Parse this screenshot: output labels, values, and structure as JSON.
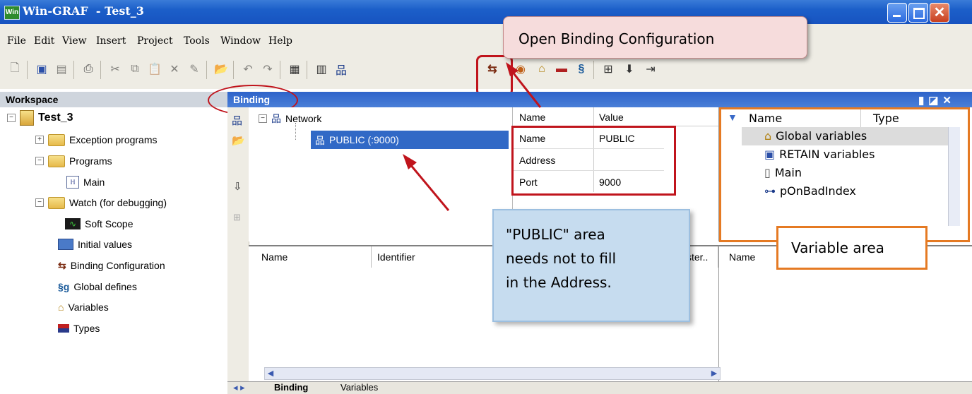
{
  "window": {
    "title": "Win-GRAF  - Test_3",
    "icon_label": "Win"
  },
  "menu": [
    "File",
    "Edit",
    "View",
    "Insert",
    "Project",
    "Tools",
    "Window",
    "Help"
  ],
  "callout_open": "Open Binding Configuration",
  "workspace": {
    "title": "Workspace",
    "root": "Test_3",
    "items": [
      {
        "label": "Exception programs",
        "icon": "folder-icon"
      },
      {
        "label": "Programs",
        "icon": "folder-icon"
      },
      {
        "label": "Main",
        "icon": "program-icon"
      },
      {
        "label": "Watch (for debugging)",
        "icon": "folder-icon"
      },
      {
        "label": "Soft Scope",
        "icon": "scope-icon"
      },
      {
        "label": "Initial values",
        "icon": "table-icon"
      },
      {
        "label": "Binding Configuration",
        "icon": "binding-icon"
      },
      {
        "label": "Global defines",
        "icon": "defines-icon"
      },
      {
        "label": "Variables",
        "icon": "house-icon"
      },
      {
        "label": "Types",
        "icon": "types-icon"
      }
    ]
  },
  "binding": {
    "title": "Binding",
    "network_label": "Network",
    "public_label": "PUBLIC (:9000)",
    "props": {
      "headers": [
        "Name",
        "Value"
      ],
      "rows": [
        [
          "Name",
          "PUBLIC"
        ],
        [
          "Address",
          ""
        ],
        [
          "Port",
          "9000"
        ]
      ]
    },
    "list_headers": [
      "Name",
      "Identifier",
      "ster.."
    ],
    "list2_headers": [
      "Name"
    ],
    "note_lines": [
      "\"PUBLIC\" area",
      "needs not to fill",
      "in the Address."
    ],
    "tabs": [
      "Binding",
      "Variables"
    ]
  },
  "variables": {
    "headers": [
      "Name",
      "Type"
    ],
    "rows": [
      "Global variables",
      "RETAIN variables",
      "Main",
      "pOnBadIndex"
    ],
    "area_label": "Variable area"
  }
}
